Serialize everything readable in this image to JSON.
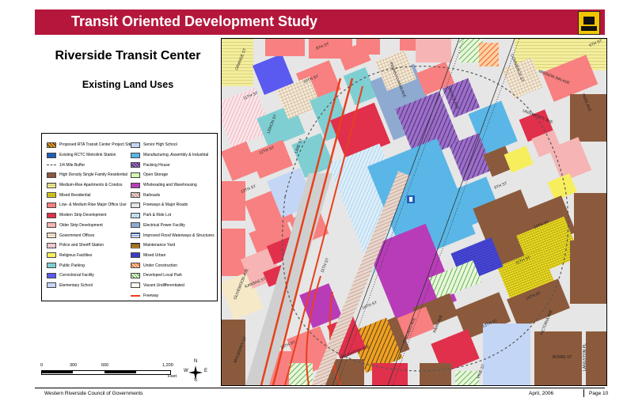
{
  "header": {
    "title": "Transit Oriented Development Study"
  },
  "map_title": "Riverside Transit Center",
  "map_subtitle": "Existing Land Uses",
  "colors": {
    "banner": "#b5173c",
    "high_density_sf_res": "#8b5a3c",
    "medium_rise_apts": "#f4ee9c",
    "low_medium_rise_office": "#f88080",
    "modern_strip": "#e0304c",
    "older_strip": "#f6b4b4",
    "government": "#f5e9c8",
    "religious": "#f7ee5e",
    "public_parking": "#7fcfd2",
    "correctional": "#5a5af0",
    "elementary_school": "#c4d6f6",
    "senior_high": "#c4d6f6",
    "manufacturing": "#5ab6e6",
    "open_storage": "#d6f7b4",
    "wholesale": "#b83cb8",
    "freeways": "#e4e4e4",
    "electrical": "#8eaad0",
    "mixed_urban": "#3c3cc8",
    "vacant": "#fafaf0",
    "freeway_line": "#e8401c"
  },
  "legend": {
    "left": [
      {
        "label": "Proposed RTA Transit Center Project Site",
        "icon": "hatch-orange-black"
      },
      {
        "label": "Existing RCTC Metrolink Station",
        "icon": "station-icon"
      },
      {
        "label": "1/4 Mile Buffer",
        "icon": "dashed-buffer"
      },
      {
        "label": "High Density Single Family Residential",
        "icon": "solid-brown"
      },
      {
        "label": "Medium-Rise Apartments & Condos",
        "icon": "hatch-yellow"
      },
      {
        "label": "Mixed Residential",
        "icon": "hatch-yellow-dense"
      },
      {
        "label": "Low- & Medium Rise Major Office Use",
        "icon": "solid-salmon"
      },
      {
        "label": "Modern Strip Development",
        "icon": "solid-red"
      },
      {
        "label": "Older Strip Development",
        "icon": "solid-pink"
      },
      {
        "label": "Government Offices",
        "icon": "hatch-cream"
      },
      {
        "label": "Police and Sheriff Station",
        "icon": "hatch-pink"
      },
      {
        "label": "Religious Facilities",
        "icon": "solid-yellow"
      },
      {
        "label": "Public Parking",
        "icon": "solid-teal"
      },
      {
        "label": "Correctional Facility",
        "icon": "solid-blue"
      },
      {
        "label": "Elementary School",
        "icon": "solid-light-blue"
      }
    ],
    "right": [
      {
        "label": "Senior High School",
        "icon": "solid-light-blue"
      },
      {
        "label": "Manufacturing, Assembly & Industrial",
        "icon": "solid-sky"
      },
      {
        "label": "Packing House",
        "icon": "hatch-purple"
      },
      {
        "label": "Open Storage",
        "icon": "solid-light-green"
      },
      {
        "label": "Wholesaling and Warehousing",
        "icon": "solid-magenta"
      },
      {
        "label": "Railroads",
        "icon": "hatch-brown"
      },
      {
        "label": "Freeways & Major Roads",
        "icon": "solid-grey"
      },
      {
        "label": "Park & Ride Lot",
        "icon": "hatch-light-blue"
      },
      {
        "label": "Electrical Power Facility",
        "icon": "solid-steel"
      },
      {
        "label": "Improved Flood Waterways & Structures",
        "icon": "hatch-blue-lines"
      },
      {
        "label": "Maintenance Yard",
        "icon": "hatch-orange-lines"
      },
      {
        "label": "Mixed Urban",
        "icon": "solid-navy"
      },
      {
        "label": "Under Construction",
        "icon": "hatch-orange-red"
      },
      {
        "label": "Developed Local Park",
        "icon": "hatch-green"
      },
      {
        "label": "Vacant Undifferentiated",
        "icon": "solid-offwhite"
      },
      {
        "label": "Freeway",
        "icon": "line-orange"
      }
    ]
  },
  "streets": [
    "8TH ST",
    "9TH ST",
    "10TH ST",
    "11TH ST",
    "12TH ST",
    "13TH ST",
    "14TH ST",
    "ORANGE ST",
    "LEMON ST",
    "LIME ST",
    "OLIVEWOOD AVE",
    "KANSAS ST",
    "COMMERCE ST",
    "UNIVERSITY AVE",
    "MISSION INN AVE",
    "PARK AVE",
    "BOWIE ST",
    "VICTORIA AVE",
    "LANGSTON PL",
    "HOUGHTON AVE",
    "CHICAGO AVE",
    "PENNSYLVANIA AVE",
    "VINE ST",
    "SPRUCE AVE",
    "MULBERRY ST",
    "6TH ST"
  ],
  "scalebar": {
    "ticks": [
      "0",
      "300",
      "600",
      "1,200"
    ],
    "unit": "Feet"
  },
  "north_arrow": {
    "n": "N",
    "s": "S",
    "e": "E",
    "w": "W"
  },
  "footer": {
    "org": "Western Riverside Council of Governments",
    "date": "April, 2006",
    "page": "Page 10"
  }
}
